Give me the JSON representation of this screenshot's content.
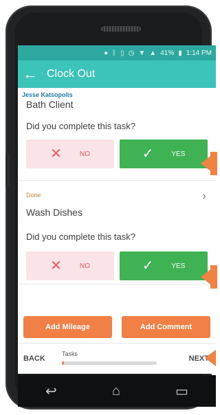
{
  "status_bar": {
    "battery": "41%",
    "time": "1:14 PM",
    "icons": [
      "location-icon",
      "bluetooth-icon",
      "vibrate-icon",
      "alarm-icon",
      "wifi-icon",
      "signal-icon",
      "battery-icon"
    ]
  },
  "app_bar": {
    "title": "Clock Out",
    "back_icon": "arrow-left-icon"
  },
  "user": {
    "name": "Jesse Katsopolis"
  },
  "tasks": [
    {
      "name": "Bath Client",
      "question": "Did you complete this task?",
      "no_label": "NO",
      "yes_label": "YES",
      "selected": "YES"
    },
    {
      "status": "Done",
      "name": "Wash Dishes",
      "question": "Did you complete this task?",
      "no_label": "NO",
      "yes_label": "YES",
      "selected": "YES"
    }
  ],
  "actions": {
    "add_mileage": "Add Mileage",
    "add_comment": "Add Comment"
  },
  "footer": {
    "back": "BACK",
    "progress_label": "Tasks",
    "next": "NEXT",
    "progress_fraction": 0.02
  },
  "colors": {
    "status_bar": "#2ca89f",
    "app_bar": "#3cc4b8",
    "accent": "#f18047",
    "yes": "#3fb253",
    "no_bg": "#fbe4e6",
    "no_text": "#ef5662"
  }
}
